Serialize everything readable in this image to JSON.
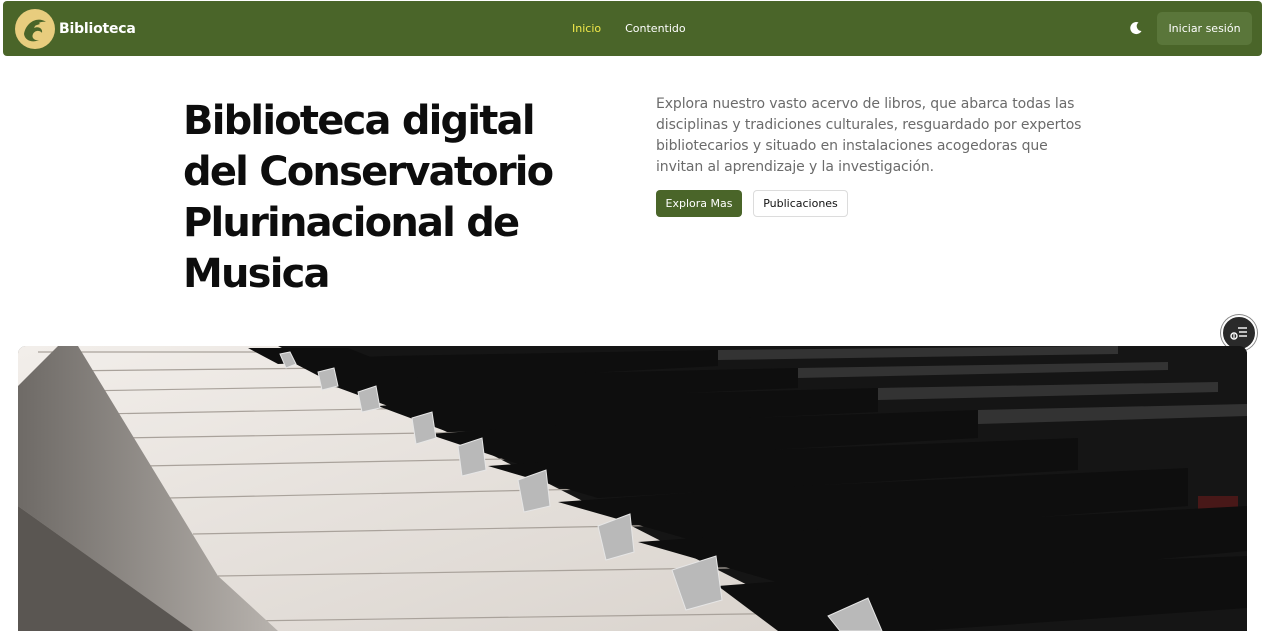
{
  "navbar": {
    "brand": "Biblioteca",
    "links": [
      {
        "label": "Inicio",
        "active": true
      },
      {
        "label": "Contentido",
        "active": false
      }
    ],
    "theme_icon": "moon-icon",
    "login_label": "Iniciar sesión"
  },
  "hero": {
    "title": "Biblioteca digital del Conservatorio Plurinacional de Musica",
    "description": "Explora nuestro vasto acervo de libros, que abarca todas las disciplinas y tradiciones culturales, resguardado por expertos bibliotecarios y situado en instalaciones acogedoras que invitan al aprendizaje y la investigación.",
    "primary_button": "Explora Mas",
    "secondary_button": "Publicaciones"
  },
  "fab_icon": "filter-list-icon",
  "image_subject": "piano-keys-image",
  "colors": {
    "primary": "#4a6529",
    "active_link": "#f1e94a",
    "logo_bg": "#e8cd7e"
  }
}
